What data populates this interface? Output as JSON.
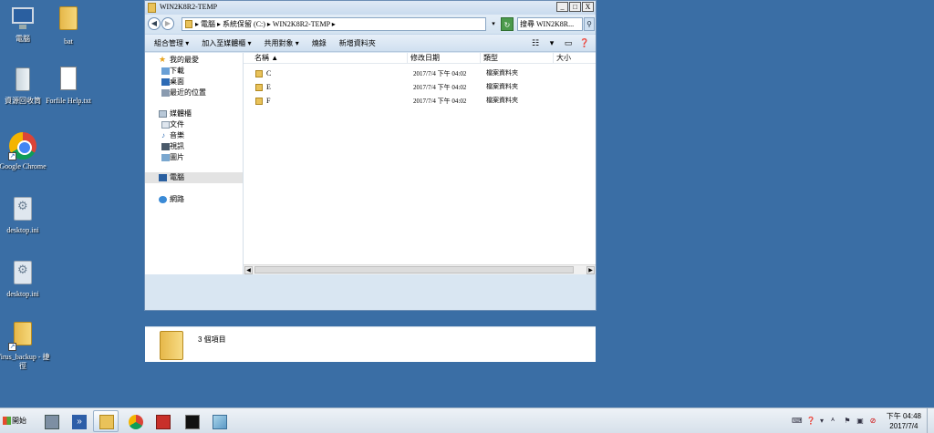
{
  "desktop": {
    "icons": [
      {
        "label": "電腦"
      },
      {
        "label": "bat"
      },
      {
        "label": "資源回收筒"
      },
      {
        "label": "Forfile Help.txt"
      },
      {
        "label": "Google Chrome"
      },
      {
        "label": "desktop.ini"
      },
      {
        "label": "desktop.ini"
      },
      {
        "label": "Virus_backup - 捷徑"
      }
    ]
  },
  "window": {
    "title": "WIN2K8R2-TEMP",
    "controls": {
      "minimize": "_",
      "maximize": "□",
      "close": "X"
    },
    "address": "▸ 電腦 ▸ 系統保留 (C:) ▸ WIN2K8R2-TEMP ▸",
    "search_placeholder": "搜尋 WIN2K8R...",
    "toolbar": {
      "organize": "組合管理 ▾",
      "include_library": "加入至媒體櫃 ▾",
      "share_with": "共用對象 ▾",
      "burn": "燒錄",
      "new_folder": "新增資料夾"
    },
    "nav": {
      "favorites": "我的最愛",
      "downloads": "下載",
      "desktop": "桌面",
      "recent": "最近的位置",
      "libraries": "媒體櫃",
      "documents": "文件",
      "music": "音樂",
      "videos": "視訊",
      "pictures": "圖片",
      "computer": "電腦",
      "network": "網路"
    },
    "columns": {
      "name": "名稱 ▲",
      "modified": "修改日期",
      "type": "類型",
      "size": "大小"
    },
    "files": [
      {
        "name": "C",
        "modified": "2017/7/4 下午 04:02",
        "type": "檔案資料夾"
      },
      {
        "name": "E",
        "modified": "2017/7/4 下午 04:02",
        "type": "檔案資料夾"
      },
      {
        "name": "F",
        "modified": "2017/7/4 下午 04:02",
        "type": "檔案資料夾"
      }
    ],
    "status": "3 個項目"
  },
  "taskbar": {
    "start": "開始",
    "clock_time": "下午 04:48",
    "clock_date": "2017/7/4"
  },
  "colors": {
    "desktop_bg": "#3a6ea5",
    "folder": "#e9c25a"
  }
}
